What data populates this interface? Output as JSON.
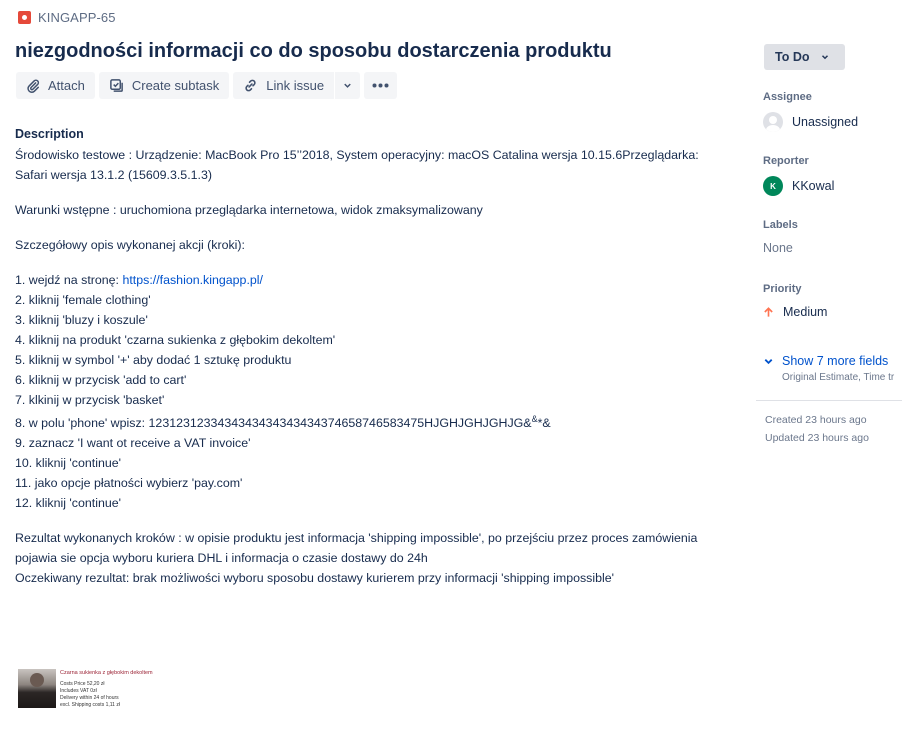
{
  "issue": {
    "key": "KINGAPP-65",
    "title": "niezgodności informacji co do sposobu dostarczenia produktu"
  },
  "toolbar": {
    "attach": "Attach",
    "create_subtask": "Create subtask",
    "link_issue": "Link issue"
  },
  "description": {
    "heading": "Description",
    "env": "Środowisko testowe : Urządzenie: MacBook Pro 15’’2018, System operacyjny: macOS Catalina wersja 10.15.6Przeglądarka: Safari wersja 13.1.2 (15609.3.5.1.3)",
    "preconditions": "Warunki wstępne : uruchomiona przeglądarka internetowa, widok zmaksymalizowany",
    "steps_heading": "Szczegółowy opis wykonanej akcji (kroki):",
    "step1_prefix": "1. wejdź na stronę: ",
    "step1_link": "https://fashion.kingapp.pl/",
    "step2": "2. kliknij 'female clothing'",
    "step3": "3. kliknij 'bluzy i koszule'",
    "step4": "4. kliknij na produkt 'czarna sukienka z głębokim dekoltem'",
    "step5": "5. kliknij w symbol '+' aby dodać 1 sztukę produktu",
    "step6": "6. kliknij w przycisk 'add to cart'",
    "step7": "7. klkinij w przycisk 'basket'",
    "step8_main": "8. w polu 'phone' wpisz: 123123123343434343434343437465874658347​5HJGHJGHJGHJG&",
    "step8_sup": "&",
    "step8_tail": "*&",
    "step9": "9. zaznacz 'I want ot receive a VAT invoice'",
    "step10": "10. kliknij 'continue'",
    "step11": "11. jako opcje płatności wybierz 'pay.com'",
    "step12": "12. kliknij 'continue'",
    "result": "Rezultat wykonanych kroków : w opisie produktu jest informacja 'shipping impossible', po przejściu przez proces zamówienia pojawia sie opcja wyboru kuriera DHL i informacja o czasie dostawy do 24h",
    "expected": "Oczekiwany rezultat: brak możliwości wyboru sposobu dostawy kurierem przy informacji 'shipping impossible'"
  },
  "attachment": {
    "title": "Czarna sukienka z głębokim dekoltem",
    "price": "Costs Price  52,20  zł",
    "vat": "Includes VAT 0zł",
    "delivery": "Delivery within 24 of hours",
    "shipping": "excl. Shipping costs  1,11  zł"
  },
  "sidebar": {
    "status": "To Do",
    "assignee_label": "Assignee",
    "assignee_value": "Unassigned",
    "reporter_label": "Reporter",
    "reporter_initial": "K",
    "reporter_value": "KKowal",
    "labels_label": "Labels",
    "labels_value": "None",
    "priority_label": "Priority",
    "priority_value": "Medium",
    "more_fields": "Show 7 more fields",
    "more_fields_sub": "Original Estimate, Time tr",
    "created": "Created 23 hours ago",
    "updated": "Updated 23 hours ago"
  },
  "colors": {
    "accent": "#0052cc",
    "bug": "#e5493a",
    "reporter_avatar": "#00875a",
    "priority_medium": "#ff7452"
  }
}
